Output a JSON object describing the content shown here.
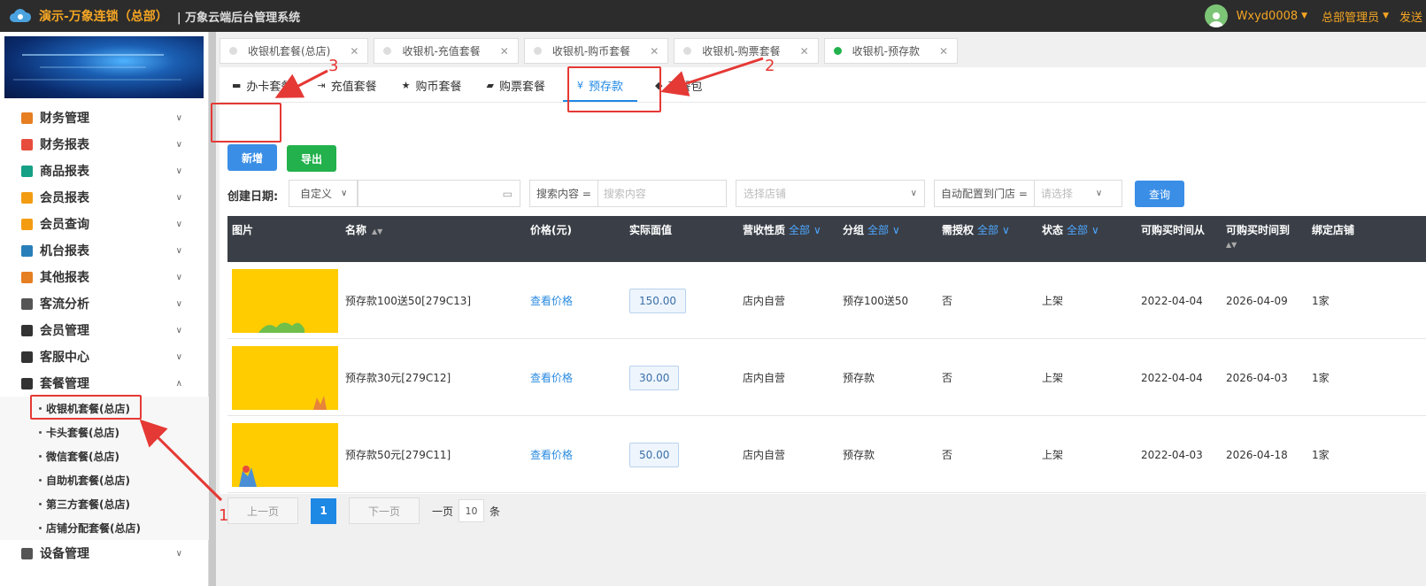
{
  "header": {
    "brand": "演示-万象连锁（总部）",
    "system": "| 万象云端后台管理系统",
    "user": "Wxyd0008",
    "role": "总部管理员",
    "extra": "发送"
  },
  "sidebar": {
    "items": [
      {
        "label": "财务管理",
        "color": "#e67e22"
      },
      {
        "label": "财务报表",
        "color": "#e74c3c"
      },
      {
        "label": "商品报表",
        "color": "#16a085"
      },
      {
        "label": "会员报表",
        "color": "#f39c12"
      },
      {
        "label": "会员查询",
        "color": "#f39c12"
      },
      {
        "label": "机台报表",
        "color": "#2980b9"
      },
      {
        "label": "其他报表",
        "color": "#e67e22"
      },
      {
        "label": "客流分析",
        "color": "#555555"
      },
      {
        "label": "会员管理",
        "color": "#333333"
      },
      {
        "label": "客服中心",
        "color": "#333333"
      },
      {
        "label": "套餐管理",
        "color": "#333333"
      }
    ],
    "sub_items": [
      "收银机套餐(总店)",
      "卡头套餐(总店)",
      "微信套餐(总店)",
      "自助机套餐(总店)",
      "第三方套餐(总店)",
      "店铺分配套餐(总店)"
    ],
    "bottom_item": "设备管理"
  },
  "tabs": [
    {
      "label": "收银机套餐(总店)",
      "active": false
    },
    {
      "label": "收银机-充值套餐",
      "active": false
    },
    {
      "label": "收银机-购币套餐",
      "active": false
    },
    {
      "label": "收银机-购票套餐",
      "active": false
    },
    {
      "label": "收银机-预存款",
      "active": true
    }
  ],
  "subtabs": [
    {
      "label": "办卡套餐",
      "icon": "▬"
    },
    {
      "label": "充值套餐",
      "icon": "⇥"
    },
    {
      "label": "购币套餐",
      "icon": "★"
    },
    {
      "label": "购票套餐",
      "icon": "▰"
    },
    {
      "label": "预存款",
      "icon": "¥"
    },
    {
      "label": "套餐包",
      "icon": "◆"
    }
  ],
  "buttons": {
    "add": "新增",
    "export": "导出",
    "query": "查询"
  },
  "filters": {
    "date_label": "创建日期:",
    "date_mode": "自定义",
    "search_label": "搜索内容 =",
    "search_placeholder": "搜索内容",
    "store_placeholder": "选择店铺",
    "auto_label": "自动配置到门店 =",
    "auto_placeholder": "请选择"
  },
  "table": {
    "headers": {
      "image": "图片",
      "name": "名称",
      "price": "价格(元)",
      "face": "实际面值",
      "nature": "营收性质",
      "group": "分组",
      "auth": "需授权",
      "status": "状态",
      "from": "可购买时间从",
      "to": "可购买时间到",
      "store": "绑定店铺"
    },
    "filter_all": "全部",
    "rows": [
      {
        "name": "预存款100送50[279C13]",
        "price": "查看价格",
        "face": "150.00",
        "nature": "店内自营",
        "group": "预存100送50",
        "auth": "否",
        "status": "上架",
        "from": "2022-04-04",
        "to": "2026-04-09",
        "store": "1家"
      },
      {
        "name": "预存款30元[279C12]",
        "price": "查看价格",
        "face": "30.00",
        "nature": "店内自营",
        "group": "预存款",
        "auth": "否",
        "status": "上架",
        "from": "2022-04-04",
        "to": "2026-04-03",
        "store": "1家"
      },
      {
        "name": "预存款50元[279C11]",
        "price": "查看价格",
        "face": "50.00",
        "nature": "店内自营",
        "group": "预存款",
        "auth": "否",
        "status": "上架",
        "from": "2022-04-03",
        "to": "2026-04-18",
        "store": "1家"
      }
    ]
  },
  "pager": {
    "prev": "上一页",
    "page": "1",
    "next": "下一页",
    "per_label": "一页",
    "per_value": "10",
    "unit": "条"
  },
  "annotations": {
    "n1": "1",
    "n2": "2",
    "n3": "3"
  }
}
